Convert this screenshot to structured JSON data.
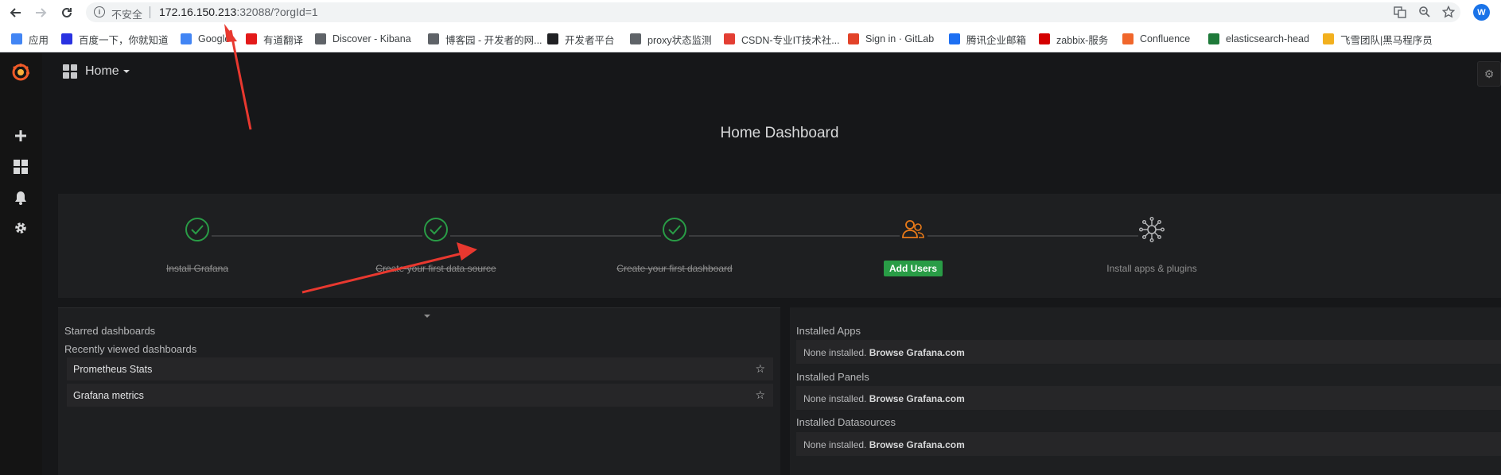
{
  "browser": {
    "nav": {
      "back": "back-arrow-icon",
      "forward": "forward-arrow-icon",
      "reload": "reload-icon"
    },
    "address": {
      "security_label": "不安全",
      "url_host": "172.16.150.213",
      "url_rest": ":32088/?orgId=1"
    },
    "avatar_letter": "W",
    "bookmarks": [
      {
        "label": "应用",
        "icon": "apps-grid-icon",
        "color": "#4285f4"
      },
      {
        "label": "百度一下，你就知道",
        "icon": "baidu-icon",
        "color": "#2932e1"
      },
      {
        "label": "Google",
        "icon": "google-icon",
        "color": "#4285f4"
      },
      {
        "label": "有道翻译",
        "icon": "youdao-icon",
        "color": "#e31a1a"
      },
      {
        "label": "Discover - Kibana",
        "icon": "page-icon",
        "color": "#5f6368"
      },
      {
        "label": "博客园 - 开发者的网...",
        "icon": "cnblogs-icon",
        "color": "#5f6368"
      },
      {
        "label": "开发者平台",
        "icon": "dev-platform-icon",
        "color": "#202124"
      },
      {
        "label": "proxy状态监测",
        "icon": "page-icon",
        "color": "#5f6368"
      },
      {
        "label": "CSDN-专业IT技术社...",
        "icon": "csdn-icon",
        "color": "#e33e33"
      },
      {
        "label": "Sign in · GitLab",
        "icon": "gitlab-icon",
        "color": "#e24329"
      },
      {
        "label": "腾讯企业邮箱",
        "icon": "tencent-mail-icon",
        "color": "#1d6ff2"
      },
      {
        "label": "zabbix-服务",
        "icon": "zabbix-icon",
        "color": "#d40000"
      },
      {
        "label": "Confluence",
        "icon": "confluence-icon",
        "color": "#f0662b"
      },
      {
        "label": "elasticsearch-head",
        "icon": "elasticsearch-icon",
        "color": "#1f7a3a"
      },
      {
        "label": "飞雪团队|黑马程序员",
        "icon": "trophy-icon",
        "color": "#f2b01e"
      }
    ]
  },
  "grafana": {
    "accent": "#299c46",
    "brand": "#f05a28",
    "topbar": {
      "title": "Home"
    },
    "dashboard_title": "Home Dashboard",
    "steps": [
      {
        "label": "Install Grafana",
        "done": true
      },
      {
        "label": "Create your first data source",
        "done": true
      },
      {
        "label": "Create your first dashboard",
        "done": true
      },
      {
        "label": "Add Users",
        "done": false,
        "button": true
      },
      {
        "label": "Install apps & plugins",
        "done": false
      }
    ],
    "left": {
      "starred_heading": "Starred dashboards",
      "recent_heading": "Recently viewed dashboards",
      "recent": [
        "Prometheus Stats",
        "Grafana metrics"
      ]
    },
    "right": {
      "none_text": "None installed.",
      "browse_link": "Browse Grafana.com",
      "sections": [
        "Installed Apps",
        "Installed Panels",
        "Installed Datasources"
      ]
    }
  }
}
